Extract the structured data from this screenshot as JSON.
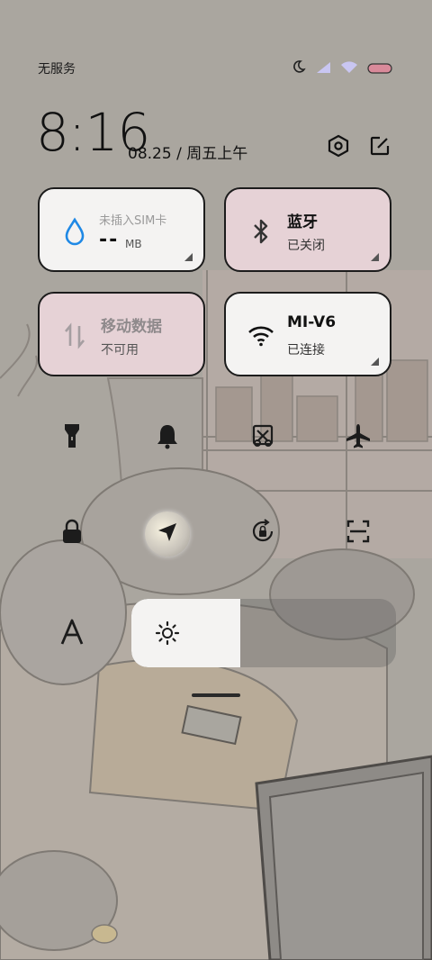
{
  "status_bar": {
    "carrier": "无服务",
    "icons": [
      "moon-icon",
      "signal-icon",
      "wifi-icon",
      "battery-icon"
    ]
  },
  "header": {
    "time": "8:16",
    "date": "08.25 / 周五上午",
    "icons": [
      "settings-icon",
      "edit-icon"
    ]
  },
  "tiles": {
    "data_usage": {
      "label": "未插入SIM卡",
      "value": "--",
      "unit": "MB",
      "icon": "droplet-icon"
    },
    "bluetooth": {
      "title": "蓝牙",
      "status": "已关闭",
      "icon": "bluetooth-icon"
    },
    "mobile_data": {
      "title": "移动数据",
      "status": "不可用",
      "icon": "data-arrows-icon"
    },
    "wifi": {
      "title": "MI-V6",
      "status": "已连接",
      "icon": "wifi-icon"
    }
  },
  "quick_toggles": [
    "flashlight-icon",
    "bell-icon",
    "screenshot-icon",
    "airplane-icon",
    "lock-icon",
    "location-icon",
    "rotation-lock-icon",
    "scan-icon"
  ],
  "reading_mode_icon": "font-a-icon",
  "brightness": {
    "level": 0.41,
    "icon": "sun-icon"
  },
  "colors": {
    "tile_light": "#f4f3f2",
    "tile_pink": "#e6d2d6",
    "accent_blue": "#1e88e5"
  }
}
